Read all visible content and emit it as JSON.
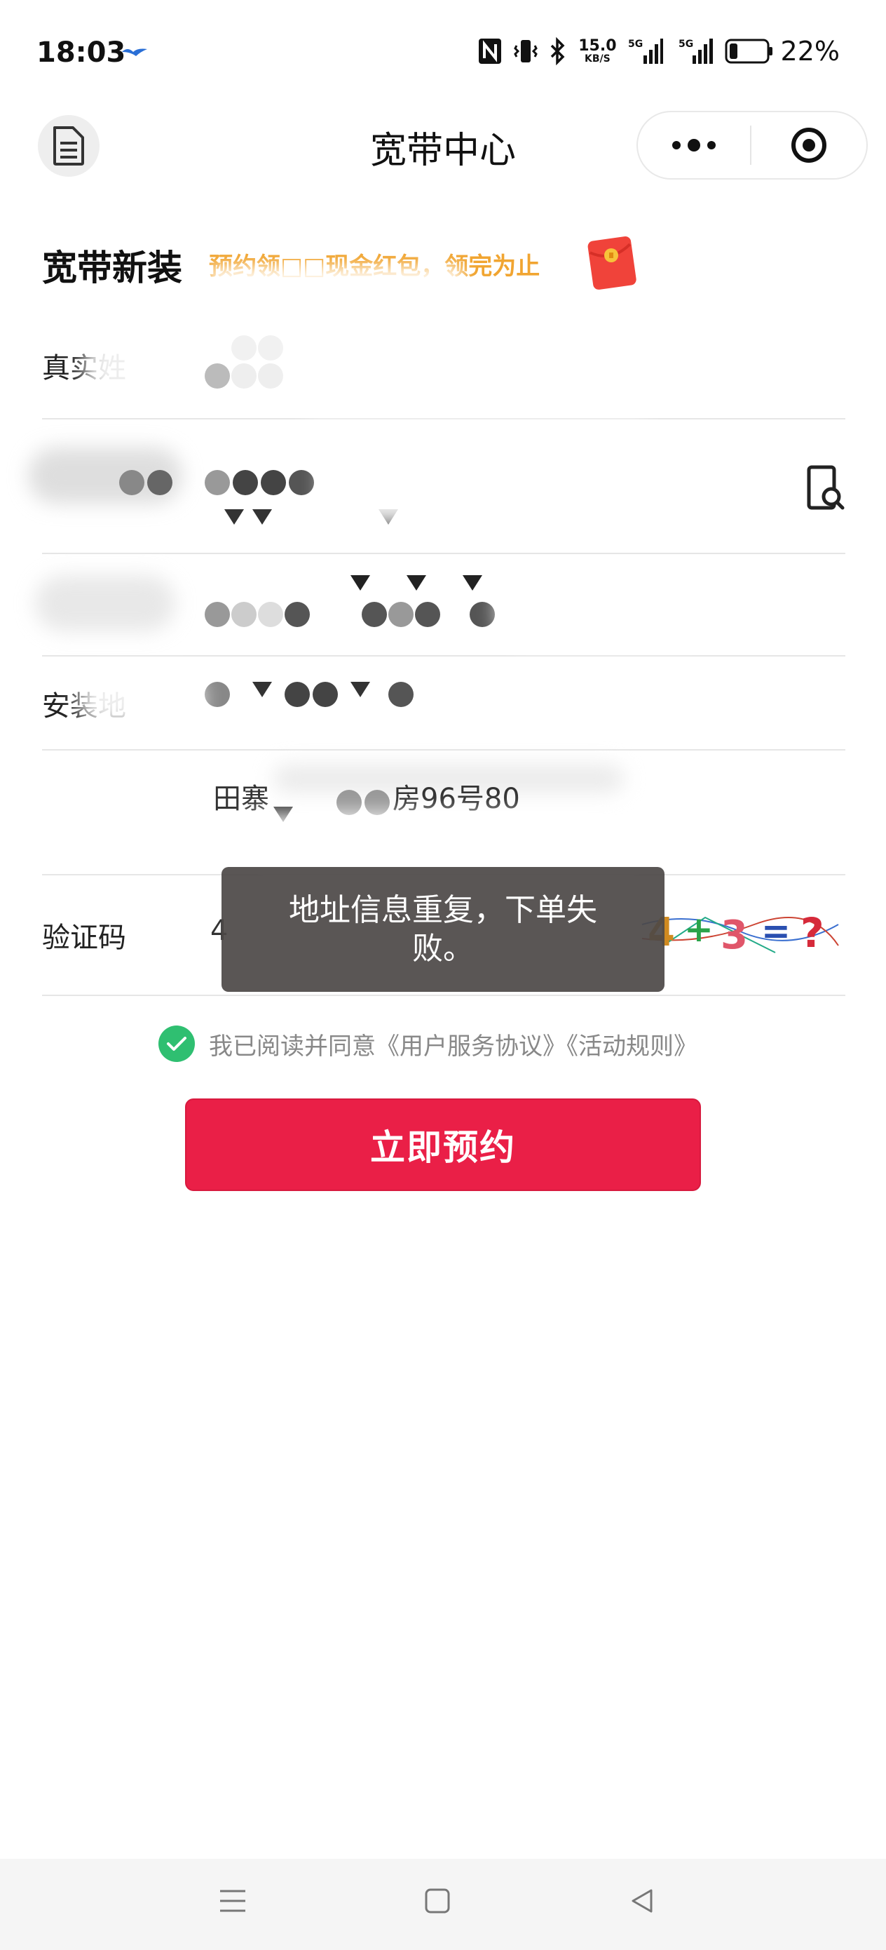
{
  "status_bar": {
    "time": "18:03",
    "net_speed_value": "15.0",
    "net_speed_unit": "KB/S",
    "signal1_label": "5G",
    "signal2_label": "5G",
    "battery_percent": "22%",
    "battery_level": 0.22,
    "icons": [
      "bird-icon",
      "nfc-icon",
      "vibrate-icon",
      "bluetooth-icon",
      "signal-icon",
      "battery-icon"
    ]
  },
  "header": {
    "title": "宽带中心"
  },
  "form": {
    "section_title": "宽带新装",
    "promo_text": "预约领□□现金红包，领完为止",
    "name_label": "真实姓",
    "address_label": "安装地",
    "address_value_partial": "田寨",
    "address_value_tail": "房96号80",
    "captcha_label": "验证码",
    "captcha_value": "4"
  },
  "toast": {
    "message": "地址信息重复，下单失败。"
  },
  "agreement": {
    "text": "我已阅读并同意《用户服务协议》《活动规则》",
    "checked": true
  },
  "submit": {
    "label": "立即预约"
  },
  "colors": {
    "accent_red": "#ea1f47",
    "promo_orange": "#f1a531",
    "check_green": "#2fbf71",
    "toast_bg": "#4c4846"
  }
}
